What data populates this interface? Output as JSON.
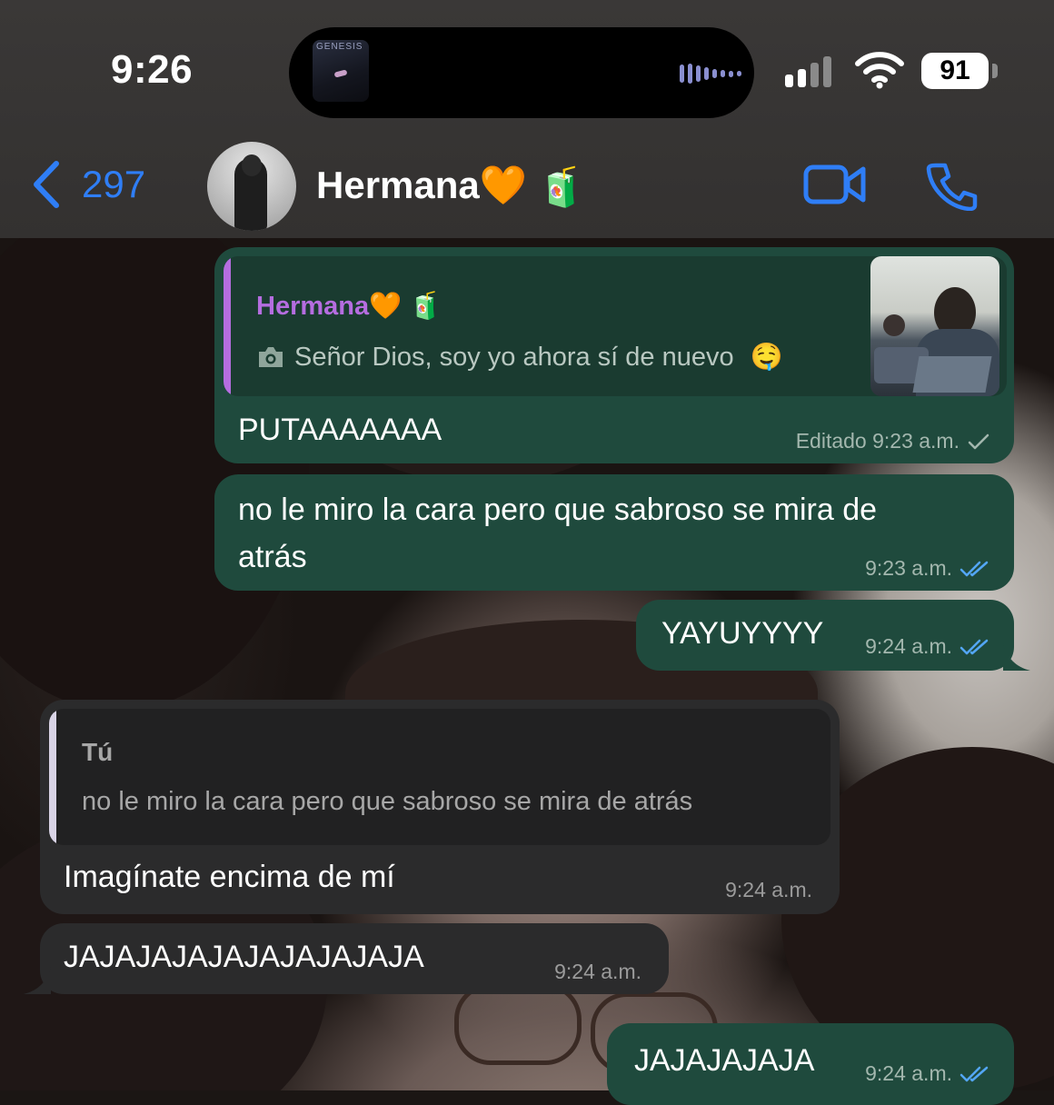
{
  "status_bar": {
    "time": "9:26",
    "island_art_text": "GENESIS",
    "battery": "91"
  },
  "header": {
    "back_count": "297",
    "contact_name": "Hermana🧡",
    "contact_emoji": "🧃"
  },
  "messages": [
    {
      "direction": "out",
      "quote": {
        "author": "Hermana🧡",
        "author_emoji": "🧃",
        "text": "Señor Dios, soy yo ahora sí de nuevo",
        "text_emoji": "🤤",
        "icon": "camera-icon"
      },
      "text": "PUTAAAAAAA",
      "time": "Editado 9:23 a.m.",
      "status": "sent"
    },
    {
      "direction": "out",
      "text_line1": "no le miro la cara pero que sabroso se mira de",
      "text_line2": "atrás",
      "time": "9:23 a.m.",
      "status": "read"
    },
    {
      "direction": "out",
      "text": "YAYUYYYY",
      "time": "9:24 a.m.",
      "status": "read"
    },
    {
      "direction": "in",
      "quote": {
        "author": "Tú",
        "text": "no le miro la cara pero que sabroso se mira de atrás"
      },
      "text": "Imagínate encima de mí",
      "time": "9:24 a.m."
    },
    {
      "direction": "in",
      "text": "JAJAJAJAJAJAJAJAJAJA",
      "time": "9:24 a.m."
    },
    {
      "direction": "out",
      "text": "JAJAJAJAJA",
      "time": "9:24 a.m.",
      "status": "read"
    }
  ],
  "colors": {
    "accent": "#2f7ef6",
    "out_bubble": "#1f4a3d",
    "in_bubble": "#2b2b2c",
    "quote_author_hermana": "#b56de0",
    "read_check": "#53a6f5"
  }
}
